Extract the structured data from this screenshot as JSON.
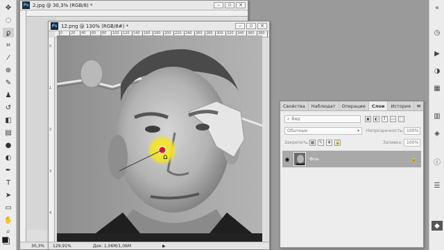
{
  "doc_back": {
    "title": "2.jpg @ 30,3% (RGB/8) *",
    "zoom": "30,3%",
    "btn_min": "–",
    "btn_max": "▫",
    "btn_close": "×"
  },
  "doc_front": {
    "title": "12.png @ 130% (RGB/8#) *",
    "zoom": "129,91%",
    "doc_info": "Док: 1,06M/1,06M",
    "btn_min": "–",
    "btn_max": "▫",
    "btn_close": "×",
    "ruler_h": [
      "0",
      "20",
      "40",
      "60",
      "80",
      "100",
      "120",
      "140",
      "160",
      "180",
      "200",
      "220",
      "240",
      "260",
      "280",
      "300",
      "320",
      "340",
      "360",
      "380",
      "400"
    ],
    "ruler_v": [
      "5",
      "1",
      "2",
      "3",
      "4"
    ]
  },
  "panel": {
    "tabs": [
      "Свойства",
      "Наблюдат",
      "Операции",
      "Слои",
      "История"
    ],
    "active_tab": "Слои",
    "menu_icon": "≡",
    "search_placeholder": "Вид",
    "blend_mode": "Обычные",
    "opacity_label": "Непрозрачность:",
    "opacity_value": "100%",
    "lock_label": "Закрепить:",
    "fill_label": "Заливка:",
    "fill_value": "100%",
    "layer_name": "Фон",
    "eye_glyph": "◉",
    "lock_glyph": "🔒"
  },
  "colors": {
    "accent": "#3a6ea5",
    "swatch_fg": "#1a1a1a",
    "swatch_bg": "#ffffff",
    "brush_highlight": "#f3e32a",
    "brush_center": "#d81e1e"
  },
  "icons": {
    "tools": [
      "move-icon",
      "marquee-icon",
      "lasso-icon",
      "crop-icon",
      "eyedropper-icon",
      "healing-brush-icon",
      "brush-icon",
      "clone-stamp-icon",
      "history-brush-icon",
      "eraser-icon",
      "gradient-icon",
      "blur-icon",
      "dodge-icon",
      "pen-icon",
      "type-icon",
      "path-select-icon",
      "shape-icon",
      "hand-icon",
      "zoom-icon"
    ],
    "right": [
      "history-panel-icon",
      "actions-icon",
      "adjustments-icon",
      "styles-icon",
      "swatches-icon",
      "color-icon",
      "info-icon",
      "properties-icon",
      "layers-icon"
    ]
  }
}
